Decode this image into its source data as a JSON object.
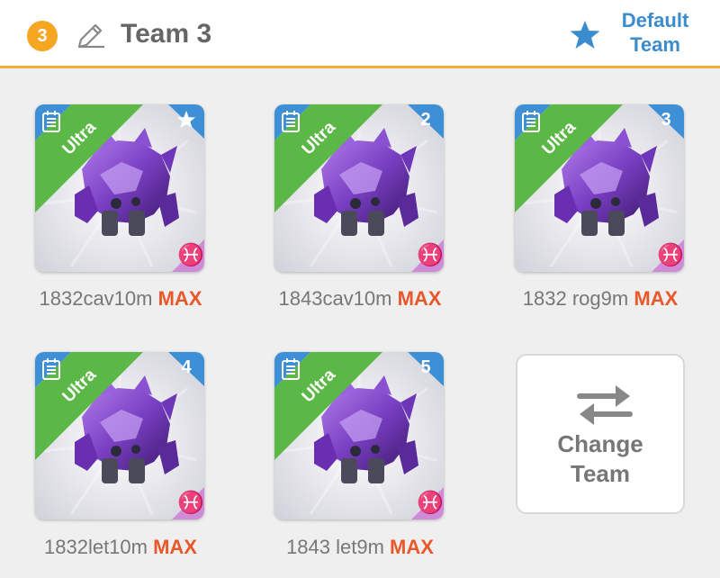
{
  "header": {
    "team_number": "3",
    "team_name": "Team 3",
    "default_label_line1": "Default",
    "default_label_line2": "Team",
    "accent_color": "#f0b040",
    "link_color": "#3a8ccf"
  },
  "slots": [
    {
      "rarity": "Ultra",
      "badge": "star-icon",
      "name": "1832cav10m",
      "level": "MAX"
    },
    {
      "rarity": "Ultra",
      "badge": "2",
      "name": "1843cav10m",
      "level": "MAX"
    },
    {
      "rarity": "Ultra",
      "badge": "3",
      "name": "1832 rog9m",
      "level": "MAX"
    },
    {
      "rarity": "Ultra",
      "badge": "4",
      "name": "1832let10m",
      "level": "MAX"
    },
    {
      "rarity": "Ultra",
      "badge": "5",
      "name": "1843 let9m",
      "level": "MAX"
    }
  ],
  "change_team": {
    "line1": "Change",
    "line2": "Team"
  },
  "colors": {
    "badge_blue": "#3d8fd6",
    "ultra_green": "#5cb846",
    "pisces_pink": "#cf8ad8",
    "max_orange": "#e8582a"
  }
}
